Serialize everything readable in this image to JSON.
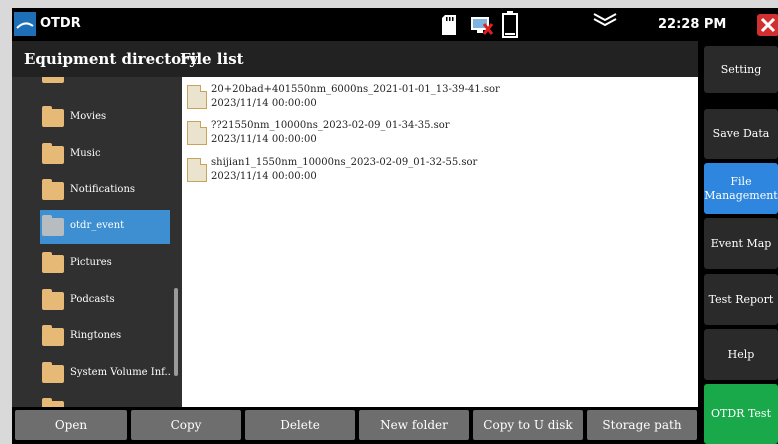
{
  "statusbar": {
    "app_title": "OTDR",
    "time": "22:28 PM",
    "icons": [
      "app-logo-icon",
      "sd-card-icon",
      "network-disconnected-icon",
      "battery-icon",
      "signal-icon",
      "close-icon"
    ]
  },
  "header": {
    "directory_title": "Equipment directory",
    "file_list_title": "File list"
  },
  "directory": {
    "items": [
      {
        "label": "Movies"
      },
      {
        "label": "Music"
      },
      {
        "label": "Notifications"
      },
      {
        "label": "otdr_event",
        "selected": true
      },
      {
        "label": "Pictures"
      },
      {
        "label": "Podcasts"
      },
      {
        "label": "Ringtones"
      },
      {
        "label": "System Volume Inf..."
      }
    ]
  },
  "files": [
    {
      "name": "20+20bad+401550nm_6000ns_2021-01-01_13-39-41.sor",
      "date": "2023/11/14  00:00:00"
    },
    {
      "name": "??21550nm_10000ns_2023-02-09_01-34-35.sor",
      "date": "2023/11/14  00:00:00"
    },
    {
      "name": "shijian1_1550nm_10000ns_2023-02-09_01-32-55.sor",
      "date": "2023/11/14  00:00:00"
    }
  ],
  "menu": {
    "setting": "Setting",
    "save_data": "Save Data",
    "file_line1": "File",
    "file_line2": "Management",
    "event_map": "Event Map",
    "test_report": "Test Report",
    "help": "Help",
    "otdr_test": "OTDR Test"
  },
  "bottom": {
    "open": "Open",
    "copy": "Copy",
    "delete": "Delete",
    "new_folder": "New folder",
    "copy_to_u_disk": "Copy to U disk",
    "storage_path": "Storage path"
  },
  "colors": {
    "accent": "#3d8fd1",
    "active_menu": "#2e86de",
    "green_button": "#1aa94a",
    "folder": "#e7b977"
  }
}
